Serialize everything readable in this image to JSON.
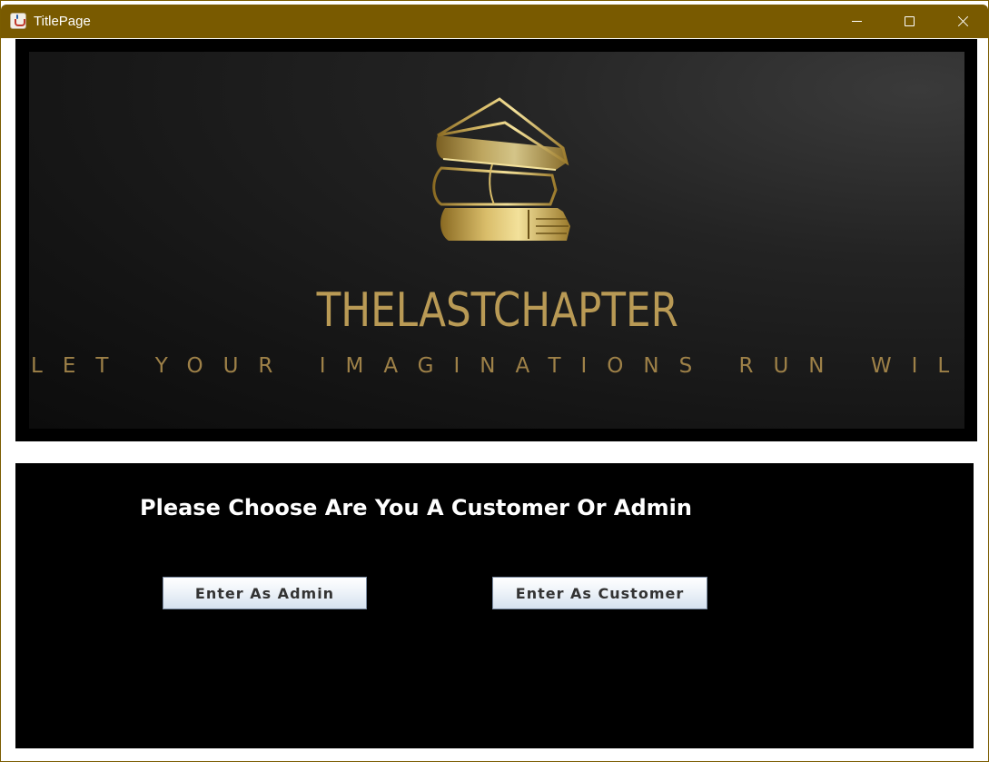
{
  "window": {
    "title": "TitlePage"
  },
  "banner": {
    "brand_name": "THELASTCHAPTER",
    "tagline": "LET YOUR IMAGINATIONS RUN WILD"
  },
  "selection": {
    "prompt": "Please Choose Are You A Customer Or Admin",
    "admin_button_label": "Enter As Admin",
    "customer_button_label": "Enter As Customer"
  },
  "icons": {
    "app": "java-cup-icon",
    "minimize": "minimize-icon",
    "maximize": "maximize-icon",
    "close": "close-icon",
    "logo": "stacked-books-logo"
  },
  "colors": {
    "titlebar": "#795a00",
    "gold": "#b99a55",
    "panel": "#000000"
  }
}
